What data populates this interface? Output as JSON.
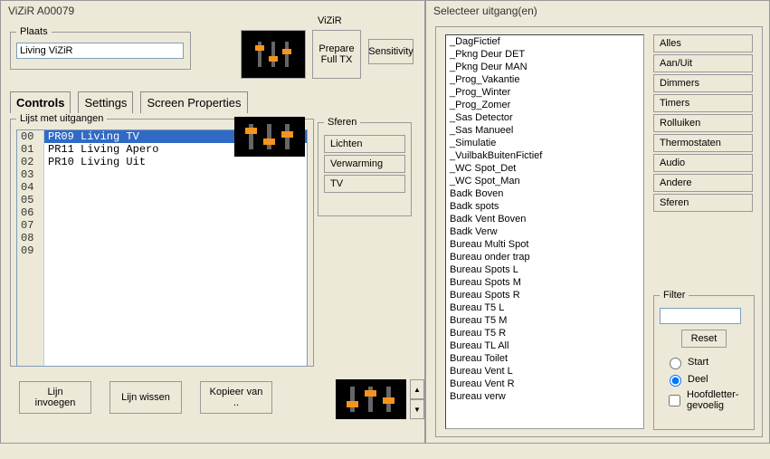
{
  "left": {
    "title": "ViZiR A00079",
    "plaats_legend": "Plaats",
    "plaats_value": "Living ViZiR",
    "vizir_label": "ViZiR",
    "prepare_label_1": "Prepare",
    "prepare_label_2": "Full TX",
    "sensitivity_label": "Sensitivity",
    "tabs": {
      "controls": "Controls",
      "settings": "Settings",
      "screen": "Screen Properties"
    },
    "lijst_legend": "Lijst met uitgangen",
    "indexes": [
      "00",
      "01",
      "02",
      "03",
      "04",
      "05",
      "06",
      "07",
      "08",
      "09"
    ],
    "rows": [
      "PR09 Living TV",
      "PR11 Living Apero",
      "PR10 Living Uit",
      "",
      "",
      "",
      "",
      "",
      "",
      ""
    ],
    "selected_row": 0,
    "sferen_legend": "Sferen",
    "sferen_buttons": [
      "Lichten",
      "Verwarming",
      "TV"
    ],
    "bottom_buttons": {
      "invoegen_1": "Lijn",
      "invoegen_2": "invoegen",
      "wissen": "Lijn wissen",
      "kopieer_1": "Kopieer van",
      "kopieer_2": ".."
    }
  },
  "right": {
    "title": "Selecteer uitgang(en)",
    "uitgangen": [
      "_DagFictief",
      "_Pkng Deur DET",
      "_Pkng Deur MAN",
      "_Prog_Vakantie",
      "_Prog_Winter",
      "_Prog_Zomer",
      "_Sas Detector",
      "_Sas Manueel",
      "_Simulatie",
      "_VuilbakBuitenFictief",
      "_WC Spot_Det",
      "_WC Spot_Man",
      "Badk Boven",
      "Badk spots",
      "Badk Vent Boven",
      "Badk Verw",
      "Bureau Multi Spot",
      "Bureau onder trap",
      "Bureau Spots L",
      "Bureau Spots M",
      "Bureau Spots R",
      "Bureau T5 L",
      "Bureau T5 M",
      "Bureau T5 R",
      "Bureau TL All",
      "Bureau Toilet",
      "Bureau Vent L",
      "Bureau Vent R",
      "Bureau verw"
    ],
    "cat_buttons": [
      "Alles",
      "Aan/Uit",
      "Dimmers",
      "Timers",
      "Rolluiken",
      "Thermostaten",
      "Audio",
      "Andere",
      "Sferen"
    ],
    "filter_legend": "Filter",
    "filter_value": "",
    "reset_label": "Reset",
    "radio_start": "Start",
    "radio_deel": "Deel",
    "radio_selected": "deel",
    "check_label_1": "Hoofdletter-",
    "check_label_2": "gevoelig"
  }
}
